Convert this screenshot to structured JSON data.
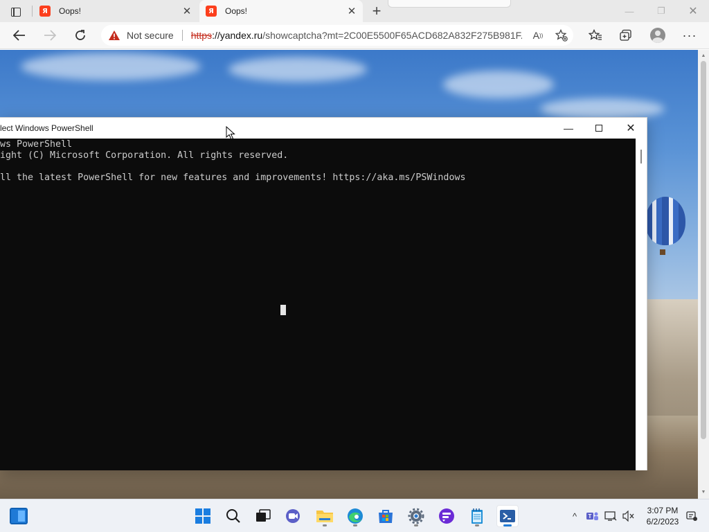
{
  "browser": {
    "tabs": [
      {
        "favicon": "Я",
        "title": "Oops!"
      },
      {
        "favicon": "Я",
        "title": "Oops!"
      }
    ],
    "new_tab_symbol": "+",
    "address": {
      "security_label": "Not secure",
      "url_protocol": "https",
      "url_host": "://yandex.ru",
      "url_path": "/showcaptcha?mt=2C00E5500F65ACD682A832F275B981F..."
    },
    "icons": {
      "tab_actions": "tab-actions-icon",
      "back": "arrow-left-icon",
      "forward": "arrow-right-icon",
      "reload": "reload-icon",
      "warning": "warning-triangle-icon",
      "read_aloud": "read-aloud-icon",
      "add_favorite": "star-plus-icon",
      "favorites": "favorites-icon",
      "collections": "collections-icon",
      "profile": "profile-icon",
      "more": "more-icon"
    }
  },
  "powershell": {
    "window_title": "lect Windows PowerShell",
    "lines": [
      "ws PowerShell",
      "ight (C) Microsoft Corporation. All rights reserved.",
      "",
      "ll the latest PowerShell for new features and improvements! https://aka.ms/PSWindows"
    ]
  },
  "taskbar": {
    "apps": [
      "widgets",
      "start",
      "search",
      "task-view",
      "teams-meet",
      "file-explorer",
      "edge",
      "microsoft-store",
      "settings",
      "app-purple",
      "notepad",
      "powershell"
    ],
    "tray_chevron": "^",
    "time": "3:07 PM",
    "date": "6/2/2023"
  },
  "colors": {
    "tab_bar": "#e9e9e9",
    "nav_bar": "#f7f7f7",
    "console_bg": "#0c0c0c",
    "console_text": "#cccccc",
    "warning_red": "#c42b1c",
    "yandex_red": "#fc3f1d",
    "taskbar": "#eef1f6"
  }
}
